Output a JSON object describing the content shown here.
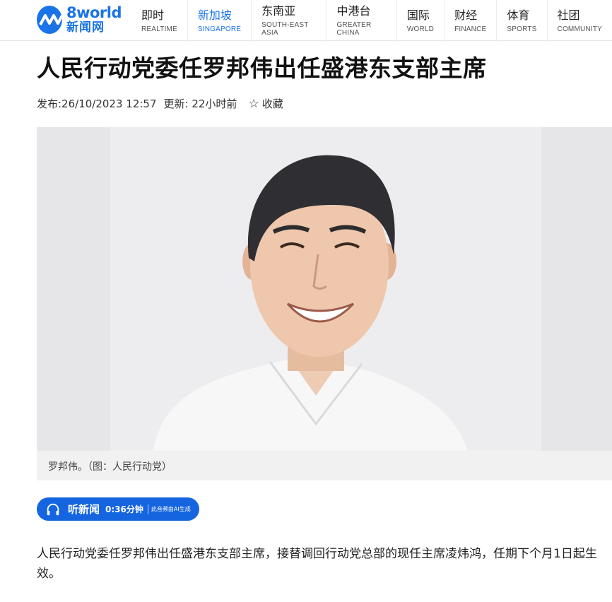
{
  "header": {
    "logo_line1": "8world",
    "logo_line2": "新闻网",
    "nav": [
      {
        "zh": "即时",
        "en": "REALTIME",
        "active": false
      },
      {
        "zh": "新加坡",
        "en": "SINGAPORE",
        "active": true
      },
      {
        "zh": "东南亚",
        "en": "SOUTH-EAST ASIA",
        "active": false
      },
      {
        "zh": "中港台",
        "en": "GREATER CHINA",
        "active": false
      },
      {
        "zh": "国际",
        "en": "WORLD",
        "active": false
      },
      {
        "zh": "财经",
        "en": "FINANCE",
        "active": false
      },
      {
        "zh": "体育",
        "en": "SPORTS",
        "active": false
      },
      {
        "zh": "社团",
        "en": "COMMUNITY",
        "active": false
      }
    ]
  },
  "article": {
    "title": "人民行动党委任罗邦伟出任盛港东支部主席",
    "published": "发布:26/10/2023 12:57",
    "updated": "更新: 22小时前",
    "bookmark_label": "收藏",
    "caption": "罗邦伟。（图：人民行动党）",
    "body": "人民行动党委任罗邦伟出任盛港东支部主席，接替调回行动党总部的现任主席凌炜鸿，任期下个月1日起生效。"
  },
  "listen": {
    "label": "听新闻",
    "duration": "0:36分钟",
    "ai_note": "此音频由AI生成"
  },
  "colors": {
    "accent": "#1a73e8",
    "listen_bg": "#1565e0"
  }
}
